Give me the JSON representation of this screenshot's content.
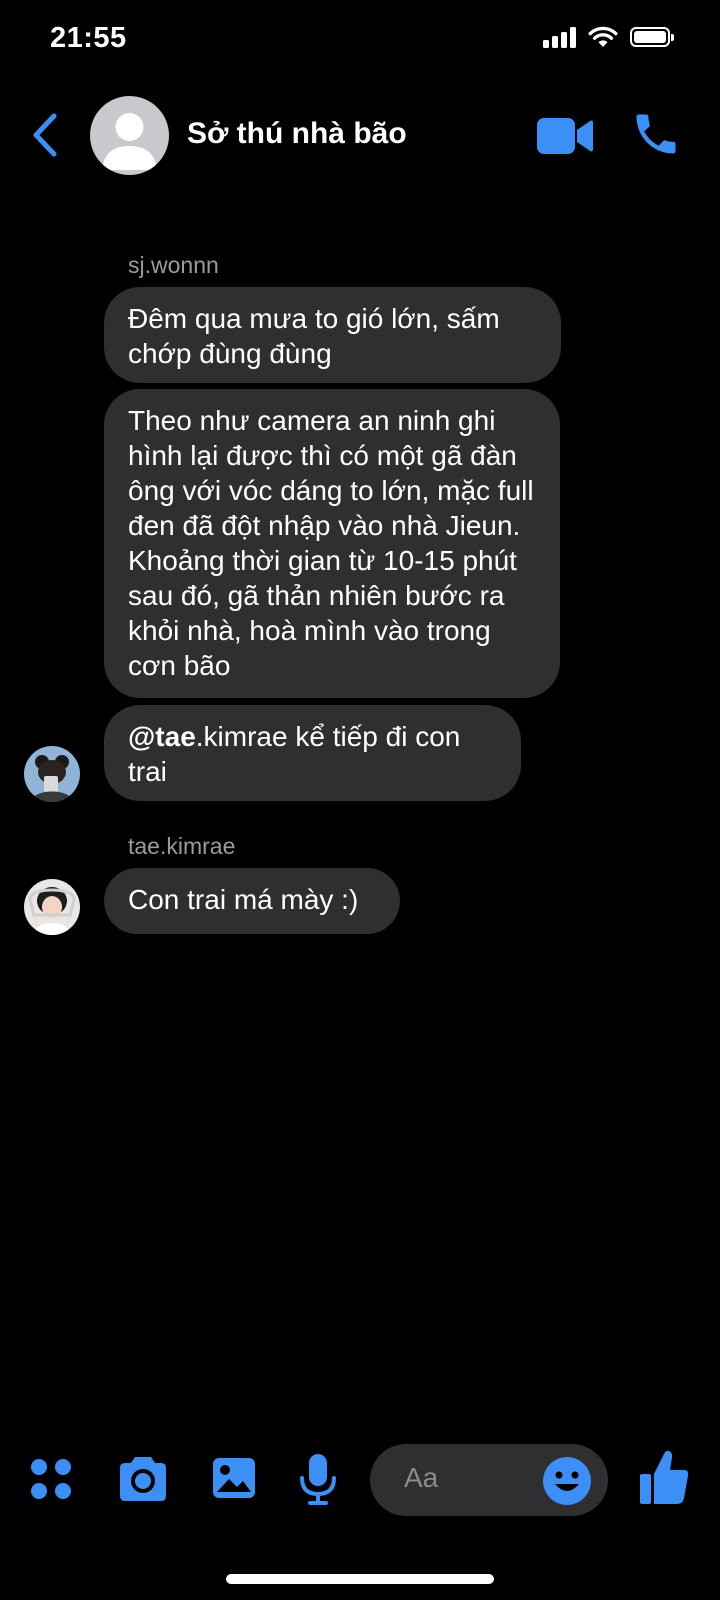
{
  "status_bar": {
    "time": "21:55"
  },
  "header": {
    "title": "Sở thú nhà bão"
  },
  "messages": [
    {
      "sender": "sj.wonnn",
      "bubbles": [
        "Đêm qua mưa to gió lớn, sấm chớp đùng đùng",
        "Theo như camera an ninh ghi hình lại được thì có một gã đàn ông với vóc dáng to lớn, mặc full đen đã đột nhập vào nhà Jieun. Khoảng thời gian từ 10-15 phút sau đó, gã thản nhiên bước ra khỏi nhà, hoà mình vào trong cơn bão"
      ],
      "mention_bubble": {
        "mention": "@tae",
        "text": ".kimrae kể tiếp đi con trai"
      }
    },
    {
      "sender": "tae.kimrae",
      "bubbles": [
        "Con trai má mày :)"
      ]
    }
  ],
  "composer": {
    "placeholder": "Aa"
  },
  "colors": {
    "accent": "#3b8ff5",
    "background": "#000000",
    "bubble": "#2f2f31",
    "secondary_text": "#9b9ba0"
  },
  "icons": {
    "back": "chevron-left-icon",
    "video": "video-camera-icon",
    "call": "phone-icon",
    "apps": "four-dots-icon",
    "camera": "camera-icon",
    "gallery": "image-icon",
    "mic": "microphone-icon",
    "emoji": "smiley-icon",
    "like": "thumbs-up-icon"
  }
}
